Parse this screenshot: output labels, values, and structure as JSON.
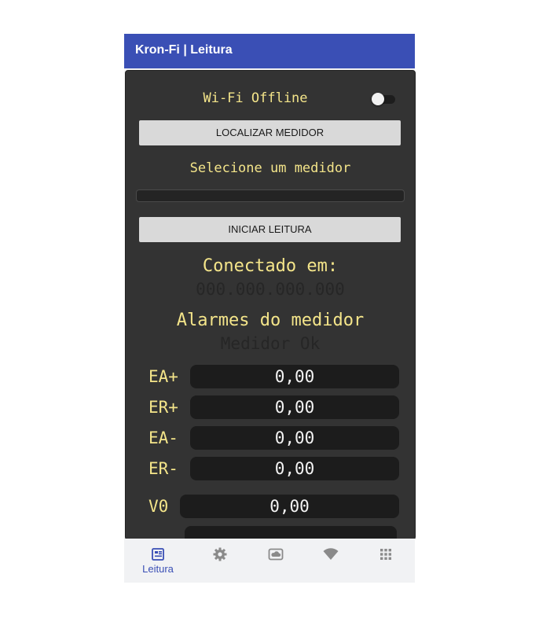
{
  "appbar": {
    "title": "Kron-Fi | Leitura"
  },
  "wifi": {
    "label": "Wi-Fi Offline",
    "enabled": false
  },
  "buttons": {
    "locate": "LOCALIZAR MEDIDOR",
    "start": "INICIAR LEITURA"
  },
  "meter_select": {
    "label": "Selecione um medidor",
    "selected": ""
  },
  "connection": {
    "label": "Conectado em:",
    "address": "000.000.000.000"
  },
  "alarms": {
    "label": "Alarmes do medidor",
    "status": "Medidor Ok"
  },
  "measurements": [
    {
      "label": "EA+",
      "value": "0,00"
    },
    {
      "label": "ER+",
      "value": "0,00"
    },
    {
      "label": "EA-",
      "value": "0,00"
    },
    {
      "label": "ER-",
      "value": "0,00"
    },
    {
      "label": "V0",
      "value": "0,00"
    }
  ],
  "nav": {
    "active": "Leitura",
    "items": [
      {
        "label": "Leitura",
        "icon": "reading-icon"
      },
      {
        "icon": "gear-icon"
      },
      {
        "icon": "cloud-icon"
      },
      {
        "icon": "wifi-icon"
      },
      {
        "icon": "apps-grid-icon"
      }
    ]
  },
  "colors": {
    "appbar": "#3a4fb5",
    "panel": "#333333",
    "label_yellow": "#f4e58a",
    "value_box": "#1c1c1c",
    "nav_active": "#3a4fb5",
    "nav_inactive": "#8a8a8a"
  }
}
